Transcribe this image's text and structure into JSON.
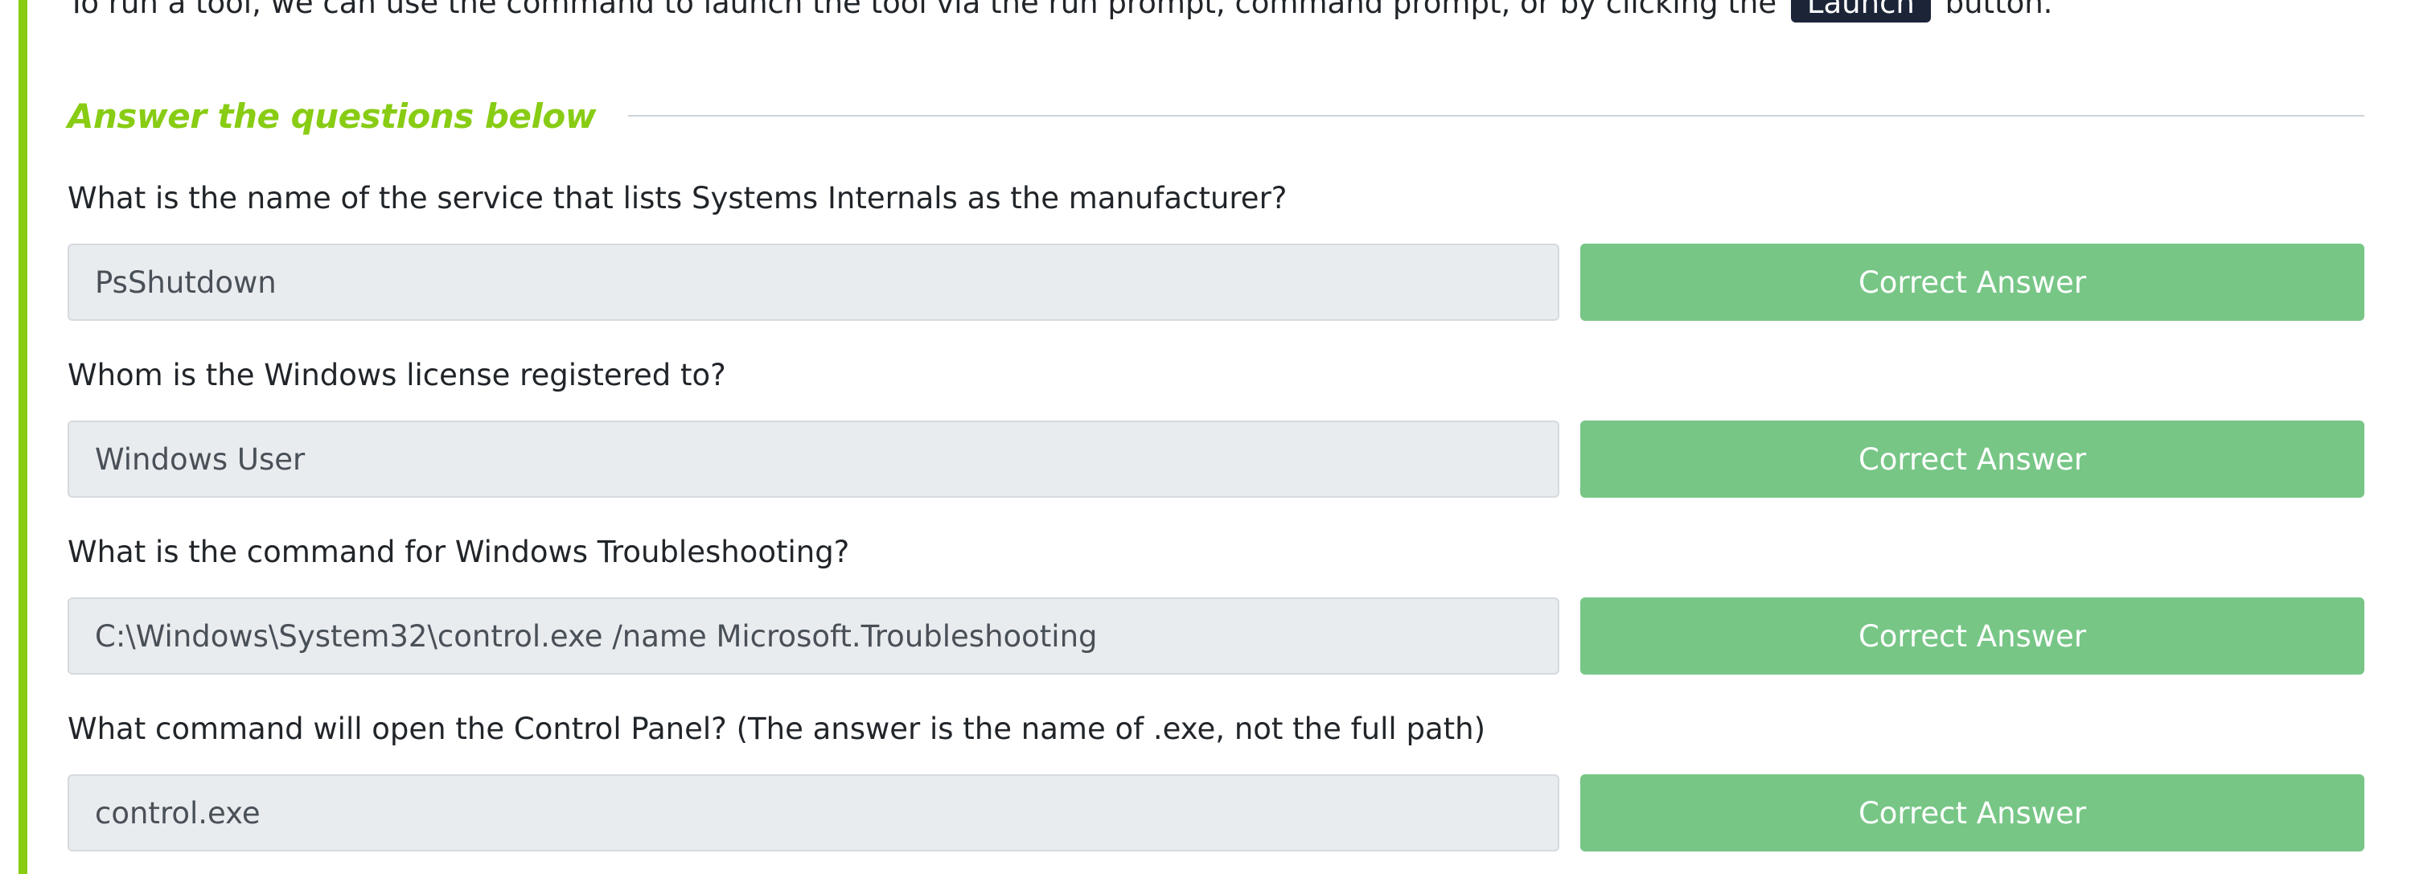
{
  "intro": {
    "before": "To run a tool, we can use the command to launch the tool via the run prompt, command prompt, or by clicking the",
    "key": "Launch",
    "after": "button."
  },
  "section": {
    "heading": "Answer the questions below"
  },
  "questions": [
    {
      "question": "What is the name of the service that lists Systems Internals as the manufacturer?",
      "answer": "PsShutdown",
      "status": "Correct Answer"
    },
    {
      "question": "Whom is the Windows license registered to?",
      "answer": "Windows User",
      "status": "Correct Answer"
    },
    {
      "question": "What is the command for Windows Troubleshooting?",
      "answer": "C:\\Windows\\System32\\control.exe /name Microsoft.Troubleshooting",
      "status": "Correct Answer"
    },
    {
      "question": "What command will open the Control Panel? (The answer is  the name of .exe, not the full path)",
      "answer": "control.exe",
      "status": "Correct Answer"
    }
  ],
  "colors": {
    "accent": "#88cc14",
    "correct": "#77c686",
    "answer_bg": "#e9ecef",
    "key_bg": "#1c2538"
  }
}
